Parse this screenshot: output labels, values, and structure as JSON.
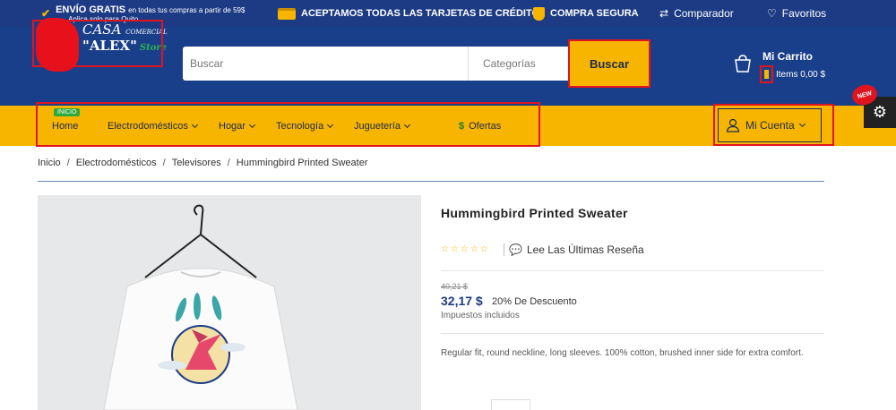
{
  "topbar": {
    "shipping_title": "ENVÍO GRATIS",
    "shipping_text": "en todas tus compras a partir de 59$",
    "shipping_sub": "Aplica solo para Quito",
    "cards": "ACEPTAMOS TODAS LAS TARJETAS DE CRÉDITO",
    "secure": "COMPRA SEGURA",
    "compare": "Comparador",
    "favorites": "Favoritos"
  },
  "logo": {
    "line1": "CASA",
    "line1b": "COMERCIAL",
    "line2": "\"ALEX\"",
    "store": "Store"
  },
  "search": {
    "placeholder": "Buscar",
    "category": "Categorías",
    "button": "Buscar"
  },
  "cart": {
    "title": "Mi Carrito",
    "items": "Items 0,00 $"
  },
  "nav": {
    "badge": "INICIO",
    "items": [
      "Home",
      "Electrodomésticos",
      "Hogar",
      "Tecnología",
      "Juguetería",
      "Ofertas"
    ],
    "account": "Mi Cuenta",
    "new_badge": "NEW"
  },
  "breadcrumb": [
    "Inicio",
    "Electrodomésticos",
    "Televisores",
    "Hummingbird Printed Sweater"
  ],
  "product": {
    "title": "Hummingbird Printed Sweater",
    "reviews": "Lee Las Últimas Reseña",
    "old_price": "40,21 $",
    "price": "32,17 $",
    "discount": "20% De Descuento",
    "tax": "Impuestos incluidos",
    "description": "Regular fit, round neckline, long sleeves. 100% cotton, brushed inner side for extra comfort.",
    "rating": 0
  },
  "colors": {
    "header": "#1a3f8a",
    "accent": "#f7b500",
    "price": "#1d3b84"
  }
}
